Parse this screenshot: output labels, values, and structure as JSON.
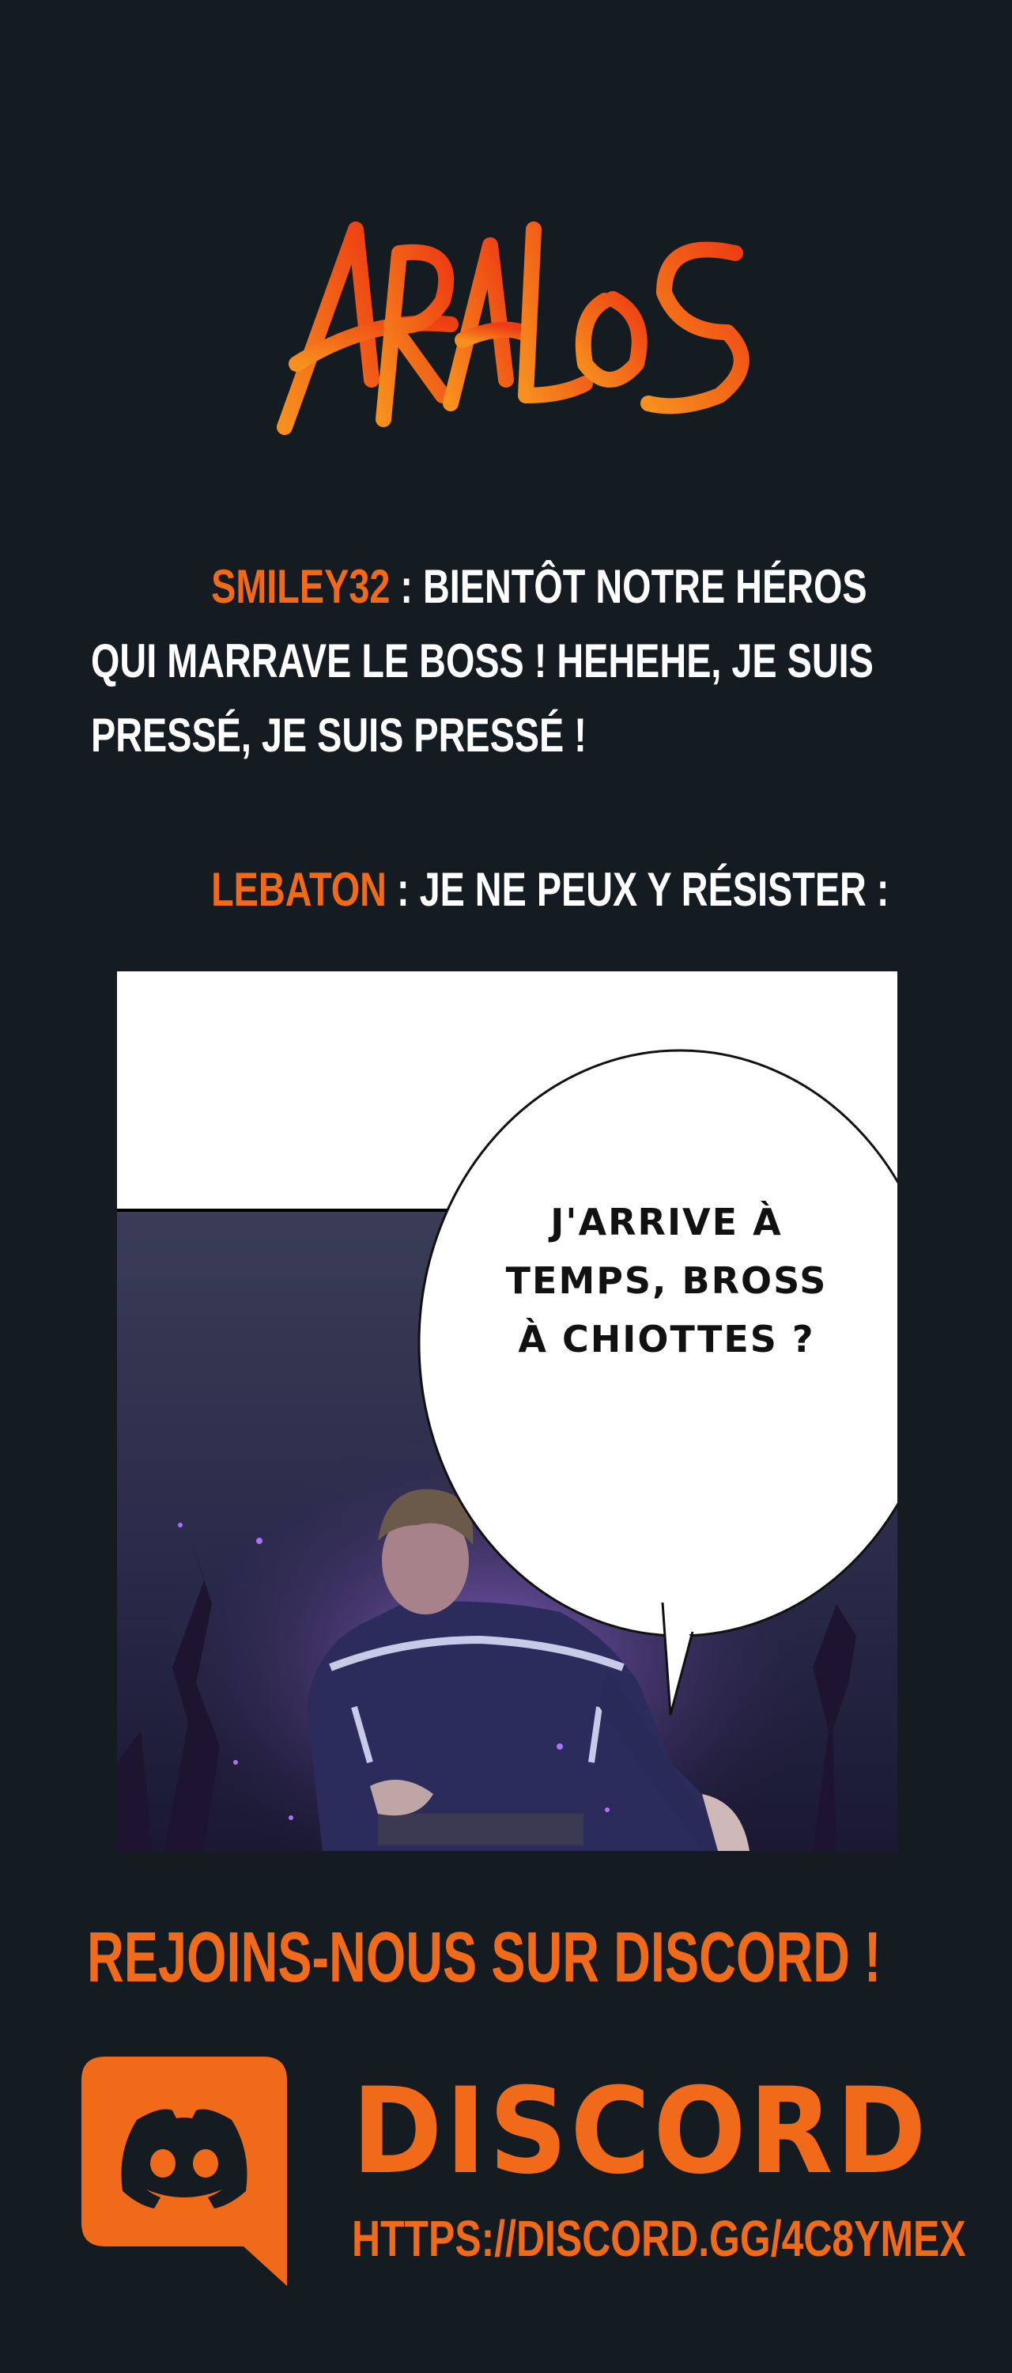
{
  "logo": {
    "text": "ARALOS",
    "color": "#f05a14"
  },
  "comments": [
    {
      "user": "SMILEY32",
      "text": " : BIENTÔT NOTRE HÉROS QUI MARRAVE LE BOSS ! HEHEHE, JE SUIS PRESSÉ, JE SUIS PRESSÉ !"
    },
    {
      "user": "LEBATON",
      "text": " : JE NE PEUX Y RÉSISTER :"
    }
  ],
  "panel": {
    "bubble_lines": [
      "J'ARRIVE À",
      "TEMPS, BROSS",
      "À CHIOTTES ?"
    ]
  },
  "cta": {
    "headline": "REJOINS-NOUS SUR DISCORD !",
    "brand": "DISCORD",
    "url": "HTTPS://DISCORD.GG/4C8YMEX",
    "accent": "#f06a1a"
  }
}
